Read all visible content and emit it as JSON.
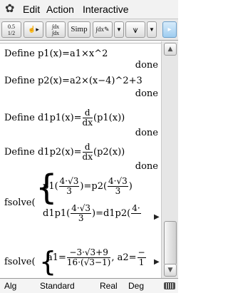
{
  "menu": {
    "items": [
      "Edit",
      "Action",
      "Interactive"
    ]
  },
  "toolbar": {
    "frac_top": "0.5",
    "frac_arrow": "↔",
    "frac_bottom": "1/2",
    "simp": "Simp"
  },
  "lines": [
    {
      "prefix": "Define p1(x)=a1×x^2"
    },
    {
      "prefix": "Define p2(x)=a2×(x−4)^2+3"
    },
    {
      "prefix": "Define d1p1(x)=",
      "fnum": "d",
      "fden": "dx",
      "suffix": "(p1(x))"
    },
    {
      "prefix": "Define d1p2(x)=",
      "fnum": "d",
      "fden": "dx",
      "suffix": "(p2(x))"
    }
  ],
  "done": "done",
  "fsolve1": {
    "label": "fsolve(",
    "row1": {
      "a": "p1(",
      "num": "4·√3",
      "den": "3",
      "mid": ")=p2(",
      "b_num": "4·√3",
      "b_den": "3",
      "end": ")"
    },
    "row2": {
      "a": "d1p1(",
      "num": "4·√3",
      "den": "3",
      "mid": ")=d1p2(",
      "b_num": "4·"
    }
  },
  "fsolve2": {
    "label": "fsolve(",
    "a1": "a1=",
    "num": "−3·√3+9",
    "den": "16·(√3−1)",
    "a2": ", a2=",
    "a2_num": "−",
    "a2_den": "1"
  },
  "status": {
    "mode": "Alg",
    "format": "Standard",
    "number": "Real",
    "angle": "Deg"
  }
}
